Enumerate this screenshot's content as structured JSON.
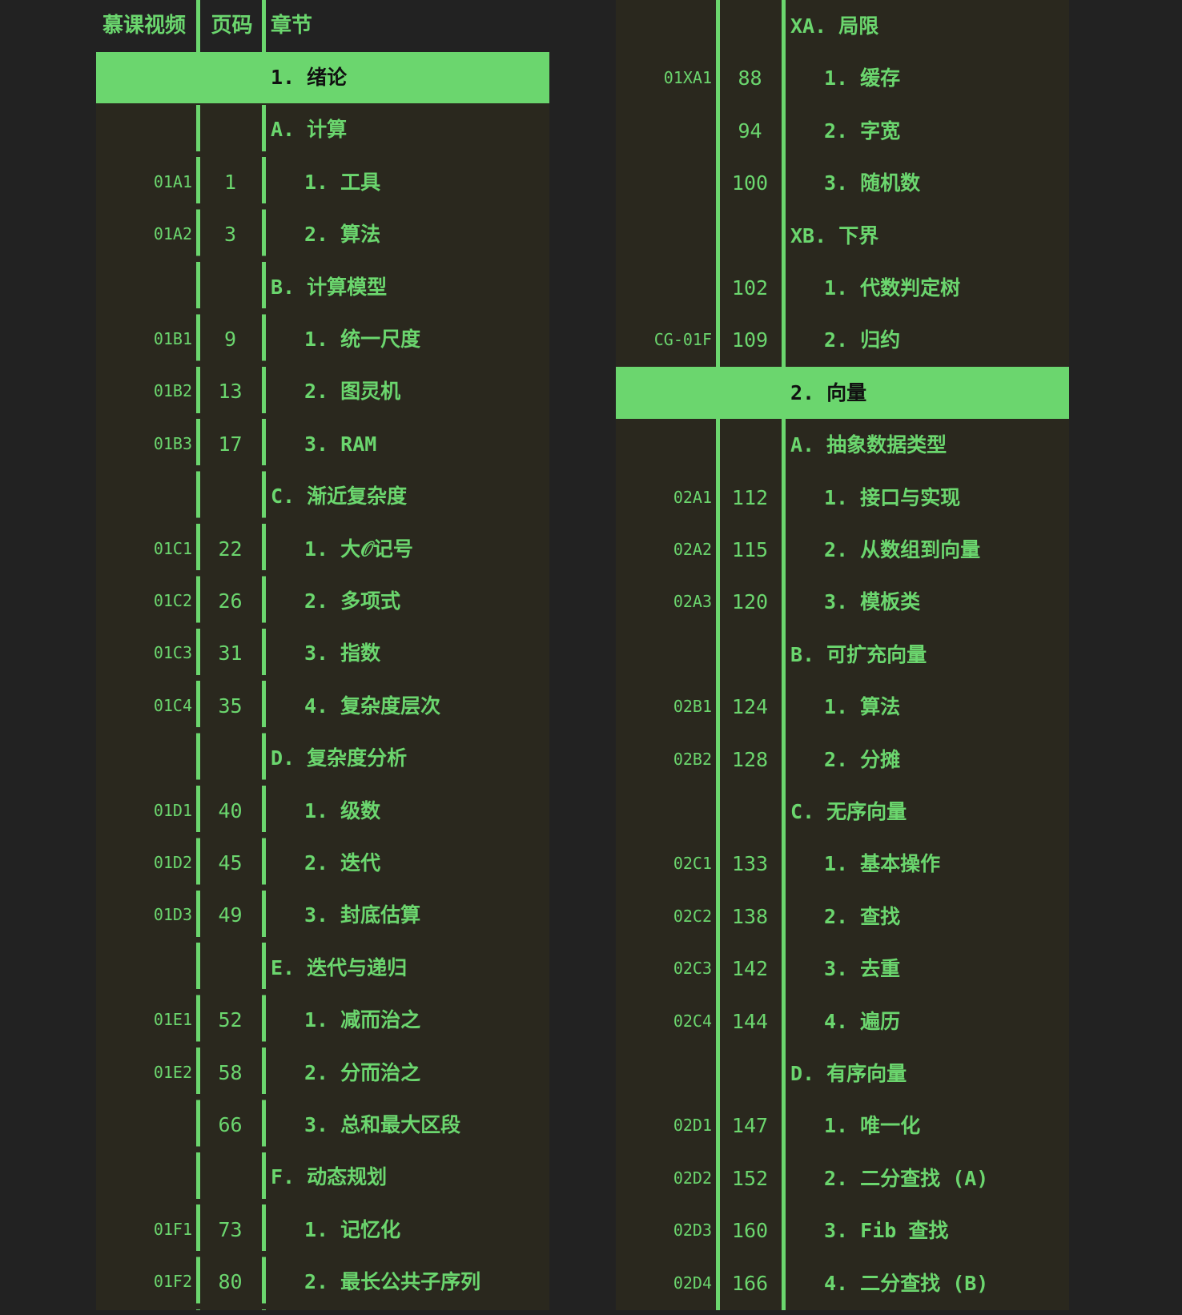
{
  "header": {
    "video": "慕课视频",
    "page": "页码",
    "chapter": "章节"
  },
  "left_rows": [
    {
      "level": 0,
      "title": "1. 绪论"
    },
    {
      "level": 1,
      "title": "A. 计算"
    },
    {
      "level": 2,
      "video": "01A1",
      "page": "1",
      "title": "1. 工具"
    },
    {
      "level": 2,
      "video": "01A2",
      "page": "3",
      "title": "2. 算法"
    },
    {
      "level": 1,
      "title": "B. 计算模型"
    },
    {
      "level": 2,
      "video": "01B1",
      "page": "9",
      "title": "1. 统一尺度"
    },
    {
      "level": 2,
      "video": "01B2",
      "page": "13",
      "title": "2. 图灵机"
    },
    {
      "level": 2,
      "video": "01B3",
      "page": "17",
      "title": "3. RAM"
    },
    {
      "level": 1,
      "title": "C. 渐近复杂度"
    },
    {
      "level": 2,
      "video": "01C1",
      "page": "22",
      "title": "1. 大𝒪记号"
    },
    {
      "level": 2,
      "video": "01C2",
      "page": "26",
      "title": "2. 多项式"
    },
    {
      "level": 2,
      "video": "01C3",
      "page": "31",
      "title": "3. 指数"
    },
    {
      "level": 2,
      "video": "01C4",
      "page": "35",
      "title": "4. 复杂度层次"
    },
    {
      "level": 1,
      "title": "D. 复杂度分析"
    },
    {
      "level": 2,
      "video": "01D1",
      "page": "40",
      "title": "1. 级数"
    },
    {
      "level": 2,
      "video": "01D2",
      "page": "45",
      "title": "2. 迭代"
    },
    {
      "level": 2,
      "video": "01D3",
      "page": "49",
      "title": "3. 封底估算"
    },
    {
      "level": 1,
      "title": "E. 迭代与递归"
    },
    {
      "level": 2,
      "video": "01E1",
      "page": "52",
      "title": "1. 减而治之"
    },
    {
      "level": 2,
      "video": "01E2",
      "page": "58",
      "title": "2. 分而治之"
    },
    {
      "level": 2,
      "page": "66",
      "title": "3. 总和最大区段"
    },
    {
      "level": 1,
      "title": "F. 动态规划"
    },
    {
      "level": 2,
      "video": "01F1",
      "page": "73",
      "title": "1. 记忆化"
    },
    {
      "level": 2,
      "video": "01F2",
      "page": "80",
      "title": "2. 最长公共子序列"
    }
  ],
  "right_rows": [
    {
      "level": 1,
      "title": "XA. 局限"
    },
    {
      "level": 2,
      "video": "01XA1",
      "page": "88",
      "title": "1. 缓存"
    },
    {
      "level": 2,
      "page": "94",
      "title": "2. 字宽"
    },
    {
      "level": 2,
      "page": "100",
      "title": "3. 随机数"
    },
    {
      "level": 1,
      "title": "XB. 下界"
    },
    {
      "level": 2,
      "page": "102",
      "title": "1. 代数判定树"
    },
    {
      "level": 2,
      "video": "CG-01F",
      "page": "109",
      "title": "2. 归约"
    },
    {
      "level": 0,
      "title": "2. 向量"
    },
    {
      "level": 1,
      "title": "A. 抽象数据类型"
    },
    {
      "level": 2,
      "video": "02A1",
      "page": "112",
      "title": "1. 接口与实现"
    },
    {
      "level": 2,
      "video": "02A2",
      "page": "115",
      "title": "2. 从数组到向量"
    },
    {
      "level": 2,
      "video": "02A3",
      "page": "120",
      "title": "3. 模板类"
    },
    {
      "level": 1,
      "title": "B. 可扩充向量"
    },
    {
      "level": 2,
      "video": "02B1",
      "page": "124",
      "title": "1. 算法"
    },
    {
      "level": 2,
      "video": "02B2",
      "page": "128",
      "title": "2. 分摊"
    },
    {
      "level": 1,
      "title": "C. 无序向量"
    },
    {
      "level": 2,
      "video": "02C1",
      "page": "133",
      "title": "1. 基本操作"
    },
    {
      "level": 2,
      "video": "02C2",
      "page": "138",
      "title": "2. 查找"
    },
    {
      "level": 2,
      "video": "02C3",
      "page": "142",
      "title": "3. 去重"
    },
    {
      "level": 2,
      "video": "02C4",
      "page": "144",
      "title": "4. 遍历"
    },
    {
      "level": 1,
      "title": "D. 有序向量"
    },
    {
      "level": 2,
      "video": "02D1",
      "page": "147",
      "title": "1. 唯一化"
    },
    {
      "level": 2,
      "video": "02D2",
      "page": "152",
      "title": "2. 二分查找 (A)"
    },
    {
      "level": 2,
      "video": "02D3",
      "page": "160",
      "title": "3. Fib 查找"
    },
    {
      "level": 2,
      "video": "02D4",
      "page": "166",
      "title": "4. 二分查找 (B)"
    }
  ]
}
